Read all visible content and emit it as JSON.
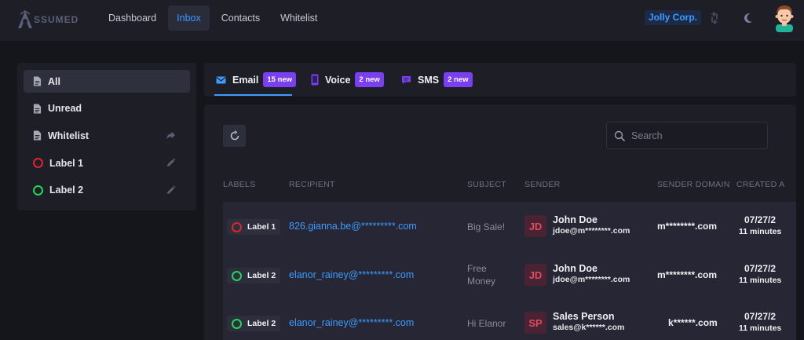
{
  "brand": {
    "logo_text": "SSUMED"
  },
  "nav": {
    "items": [
      {
        "label": "Dashboard",
        "active": false
      },
      {
        "label": "Inbox",
        "active": true
      },
      {
        "label": "Contacts",
        "active": false
      },
      {
        "label": "Whitelist",
        "active": false
      }
    ]
  },
  "header": {
    "company": "Jolly Corp.",
    "icons": [
      "swap-icon",
      "moon-icon",
      "avatar"
    ]
  },
  "sidebar": {
    "items": [
      {
        "label": "All",
        "icon": "document-icon",
        "active": true
      },
      {
        "label": "Unread",
        "icon": "document-icon"
      },
      {
        "label": "Whitelist",
        "icon": "document-icon",
        "action": "share-icon"
      },
      {
        "label": "Label 1",
        "icon": "ring-icon",
        "color": "#e0242f",
        "action": "pencil-icon"
      },
      {
        "label": "Label 2",
        "icon": "ring-icon",
        "color": "#22d65a",
        "action": "pencil-icon"
      }
    ]
  },
  "tabs": [
    {
      "label": "Email",
      "badge": "15 new",
      "icon": "mail-icon",
      "active": true
    },
    {
      "label": "Voice",
      "badge": "2 new",
      "icon": "phone-icon"
    },
    {
      "label": "SMS",
      "badge": "2 new",
      "icon": "sms-icon"
    }
  ],
  "toolbar": {
    "search_placeholder": "Search"
  },
  "table": {
    "columns": [
      "LABELS",
      "RECIPIENT",
      "SUBJECT",
      "SENDER",
      "SENDER DOMAIN",
      "CREATED A"
    ],
    "rows": [
      {
        "label": "Label 1",
        "label_color": "#e0242f",
        "recipient": "826.gianna.be@*********.com",
        "subject": "Big Sale!",
        "sender_initials": "JD",
        "sender_name": "John Doe",
        "sender_email": "jdoe@m********.com",
        "sender_domain": "m********.com",
        "created_date": "07/27/2",
        "created_ago": "11 minutes"
      },
      {
        "label": "Label 2",
        "label_color": "#22d65a",
        "recipient": "elanor_rainey@*********.com",
        "subject_line1": "Free",
        "subject_line2": "Money",
        "sender_initials": "JD",
        "sender_name": "John Doe",
        "sender_email": "jdoe@m********.com",
        "sender_domain": "m********.com",
        "created_date": "07/27/2",
        "created_ago": "11 minutes"
      },
      {
        "label": "Label 2",
        "label_color": "#22d65a",
        "recipient": "elanor_rainey@*********.com",
        "subject": "Hi Elanor",
        "sender_initials": "SP",
        "sender_name": "Sales Person",
        "sender_email": "sales@k******.com",
        "sender_domain": "k******.com",
        "created_date": "07/27/2",
        "created_ago": "11 minutes"
      }
    ]
  },
  "colors": {
    "accent": "#3d9bff",
    "badge": "#7a3ff2",
    "label1": "#e0242f",
    "label2": "#22d65a"
  }
}
